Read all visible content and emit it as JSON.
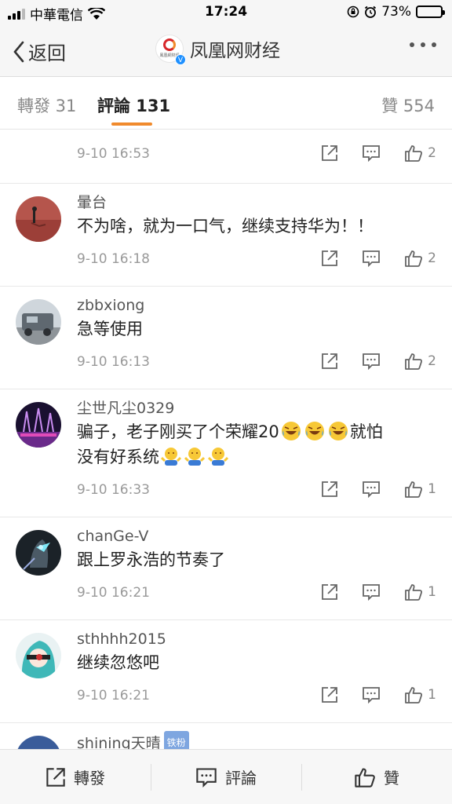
{
  "status_bar": {
    "carrier": "中華電信",
    "time": "17:24",
    "battery": "73%",
    "battery_level": 0.73
  },
  "nav": {
    "back_label": "返回",
    "title": "凤凰网财经",
    "logo_text": "鳳凰網財經"
  },
  "tabs": {
    "repost": "轉發 31",
    "comment": "評論 131",
    "like": "贊 554"
  },
  "partial_comment": {
    "date": "9-10 16:53",
    "likes": "2"
  },
  "comments": [
    {
      "name": "暈台",
      "text": "不为啥，就为一口气，继续支持华为！！",
      "date": "9-10 16:18",
      "likes": "2"
    },
    {
      "name": "zbbxiong",
      "text": "急等使用",
      "date": "9-10 16:13",
      "likes": "2"
    },
    {
      "name": "尘世凡尘0329",
      "text_a": "骗子，老子刚买了个荣耀20",
      "text_b": "就怕",
      "text_c": "没有好系统",
      "date": "9-10 16:33",
      "likes": "1"
    },
    {
      "name": "chanGe-V",
      "text": "跟上罗永浩的节奏了",
      "date": "9-10 16:21",
      "likes": "1"
    },
    {
      "name": "sthhhh2015",
      "text": "继续忽悠吧",
      "date": "9-10 16:21",
      "likes": "1"
    },
    {
      "name": "shining天晴",
      "badge": "铁粉"
    }
  ],
  "toolbar": {
    "repost": "轉發",
    "comment": "評論",
    "like": "贊"
  },
  "colors": {
    "accent": "#f08a2c",
    "verified": "#1e90ff"
  }
}
